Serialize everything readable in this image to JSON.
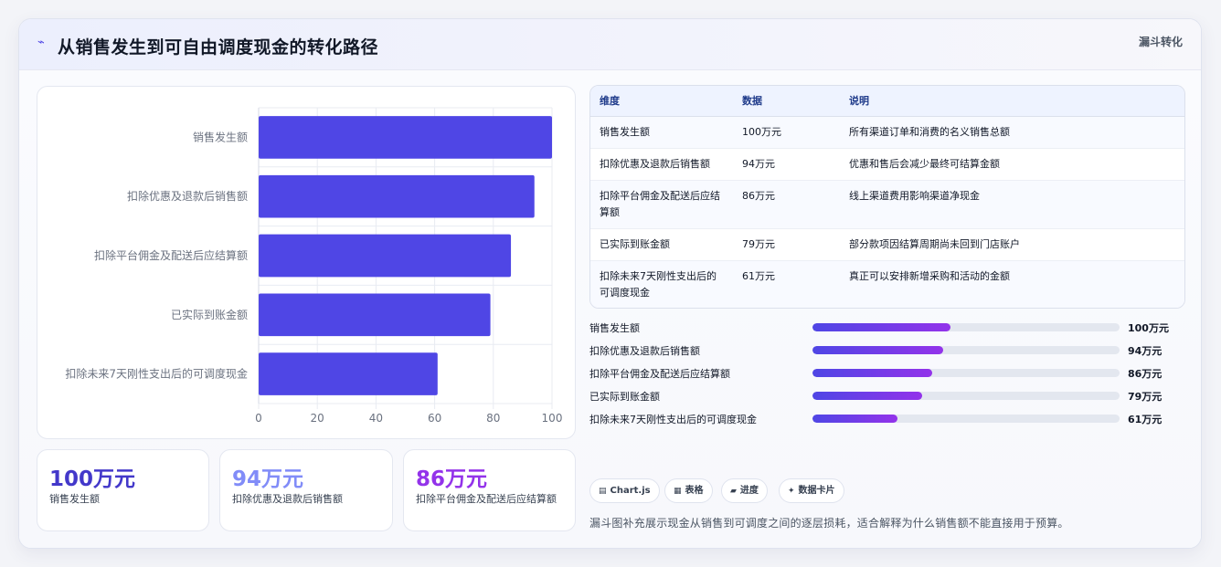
{
  "header": {
    "icon": "trend-icon",
    "title": "从销售发生到可自由调度现金的转化路径",
    "badge": "漏斗转化"
  },
  "chart_data": {
    "type": "bar",
    "orientation": "horizontal",
    "categories": [
      "销售发生额",
      "扣除优惠及退款后销售额",
      "扣除平台佣金及配送后应结算额",
      "已实际到账金额",
      "扣除未来7天刚性支出后的可调度现金"
    ],
    "values": [
      100,
      94,
      86,
      79,
      61
    ],
    "xlim": [
      0,
      100
    ],
    "xticks": [
      "0",
      "20",
      "40",
      "60",
      "80",
      "100"
    ],
    "grid": true,
    "bar_color": "#4f46e5"
  },
  "kpis": [
    {
      "value": "100万元",
      "label": "销售发生额",
      "color": "#4338ca"
    },
    {
      "value": "94万元",
      "label": "扣除优惠及退款后销售额",
      "color": "#818cf8"
    },
    {
      "value": "86万元",
      "label": "扣除平台佣金及配送后应结算额",
      "color": "#9333ea"
    }
  ],
  "table": {
    "headers": [
      "维度",
      "数据",
      "说明"
    ],
    "rows": [
      {
        "dim": "销售发生额",
        "data": "100万元",
        "desc": "所有渠道订单和消费的名义销售总额"
      },
      {
        "dim": "扣除优惠及退款后销售额",
        "data": "94万元",
        "desc": "优惠和售后会减少最终可结算金额"
      },
      {
        "dim": "扣除平台佣金及配送后应结算额",
        "data": "86万元",
        "desc": "线上渠道费用影响渠道净现金"
      },
      {
        "dim": "已实际到账金额",
        "data": "79万元",
        "desc": "部分款项因结算周期尚未回到门店账户"
      },
      {
        "dim": "扣除未来7天刚性支出后的可调度现金",
        "data": "61万元",
        "desc": "真正可以安排新增采购和活动的金额"
      }
    ]
  },
  "progress": [
    {
      "label": "销售发生额",
      "value": "100万元",
      "fraction": 0.45
    },
    {
      "label": "扣除优惠及退款后销售额",
      "value": "94万元",
      "fraction": 0.425
    },
    {
      "label": "扣除平台佣金及配送后应结算额",
      "value": "86万元",
      "fraction": 0.39
    },
    {
      "label": "已实际到账金额",
      "value": "79万元",
      "fraction": 0.357
    },
    {
      "label": "扣除未来7天刚性支出后的可调度现金",
      "value": "61万元",
      "fraction": 0.277
    }
  ],
  "chips": [
    {
      "icon": "chart-icon",
      "glyph": "▤",
      "label": "Chart.js"
    },
    {
      "icon": "table-icon",
      "glyph": "▦",
      "label": "表格"
    },
    {
      "icon": "progress-icon",
      "glyph": "▰",
      "label": "进度"
    },
    {
      "icon": "sparkle-icon",
      "glyph": "✦",
      "label": "数据卡片"
    }
  ],
  "note": "漏斗图补充展示现金从销售到可调度之间的逐层损耗，适合解释为什么销售额不能直接用于预算。"
}
